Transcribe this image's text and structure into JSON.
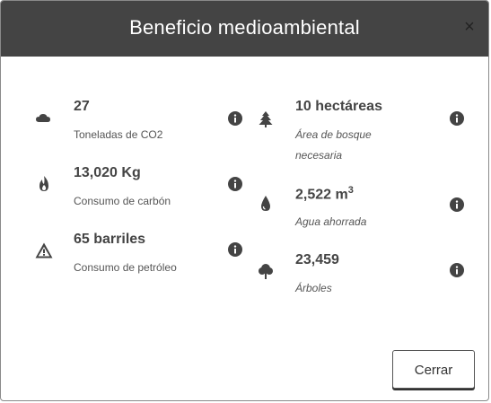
{
  "modal": {
    "title": "Beneficio medioambiental",
    "close_glyph": "×",
    "close_button_label": "Cerrar"
  },
  "left_items": [
    {
      "icon": "cloud-icon",
      "value": "27",
      "label": "Toneladas de CO2"
    },
    {
      "icon": "flame-icon",
      "value": "13,020 Kg",
      "label": "Consumo de carbón"
    },
    {
      "icon": "warning-icon",
      "value": "65 barriles",
      "label": "Consumo de petróleo"
    }
  ],
  "right_items": [
    {
      "icon": "pine-tree-icon",
      "value": "10 hectáreas",
      "label_line1": "Área de bosque",
      "label_line2": "necesaria"
    },
    {
      "icon": "water-drop-icon",
      "value": "2,522 m",
      "value_sup": "3",
      "label": "Agua ahorrada"
    },
    {
      "icon": "tree-icon",
      "value": "23,459",
      "label": "Árboles"
    }
  ],
  "colors": {
    "header_bg": "#444444",
    "header_text": "#ffffff",
    "icon": "#444444"
  }
}
